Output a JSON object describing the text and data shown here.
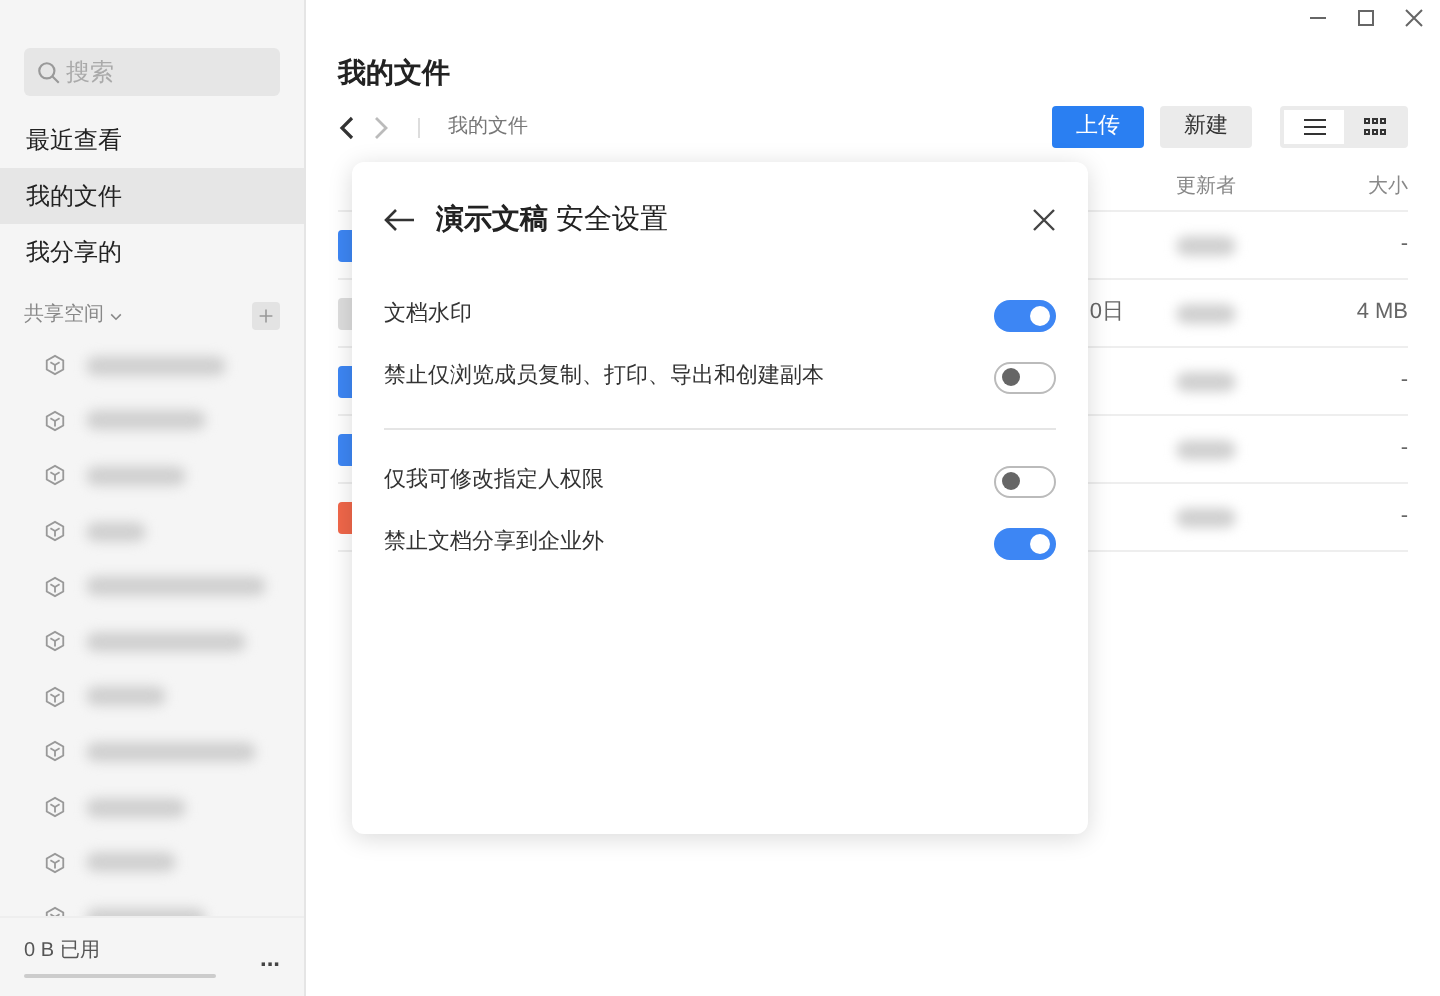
{
  "sidebar": {
    "search": {
      "placeholder": "搜索"
    },
    "nav": [
      {
        "label": "最近查看",
        "selected": false
      },
      {
        "label": "我的文件",
        "selected": true
      },
      {
        "label": "我分享的",
        "selected": false
      }
    ],
    "spaces_header": "共享空间",
    "usage": "0 B 已用",
    "more": "..."
  },
  "main": {
    "title": "我的文件",
    "breadcrumb": "我的文件",
    "upload": "上传",
    "new": "新建",
    "views": [
      {
        "kind": "list",
        "selected": true
      },
      {
        "kind": "grid",
        "selected": false
      }
    ],
    "table": {
      "columns": [
        "更新者",
        "大小"
      ],
      "rows": [
        {
          "kind": "doc",
          "size": "-"
        },
        {
          "kind": "other",
          "date": "0日",
          "size": "4 MB"
        },
        {
          "kind": "doc",
          "size": "-"
        },
        {
          "kind": "doc",
          "size": "-"
        },
        {
          "kind": "slides",
          "size": "-"
        }
      ]
    }
  },
  "dialog": {
    "title": "**演示文稿** 安全设置",
    "groups": [
      [
        {
          "label": "文档水印",
          "on": true
        },
        {
          "label": "禁止仅浏览成员复制、打印、导出和创建副本",
          "on": false
        }
      ],
      [
        {
          "label": "仅我可修改指定人权限",
          "on": false
        },
        {
          "label": "禁止文档分享到企业外",
          "on": true
        }
      ]
    ]
  }
}
